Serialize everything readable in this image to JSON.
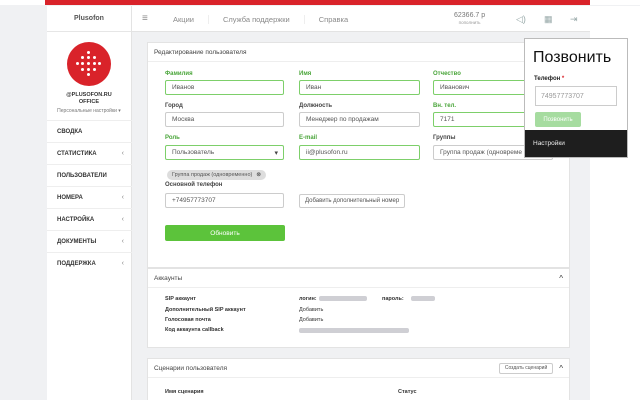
{
  "app": {
    "brand": "Plusofon"
  },
  "account": {
    "name": "@PLUSOFON.RU",
    "sub": "OFFICE",
    "settings": "Персональные настройки"
  },
  "sidebar": {
    "items": [
      {
        "label": "СВОДКА",
        "chevron": ""
      },
      {
        "label": "СТАТИСТИКА",
        "chevron": "‹"
      },
      {
        "label": "ПОЛЬЗОВАТЕЛИ",
        "chevron": ""
      },
      {
        "label": "НОМЕРА",
        "chevron": "‹"
      },
      {
        "label": "НАСТРОЙКА",
        "chevron": "‹"
      },
      {
        "label": "ДОКУМЕНТЫ",
        "chevron": "‹"
      },
      {
        "label": "ПОДДЕРЖКА",
        "chevron": "‹"
      }
    ]
  },
  "header": {
    "nav": [
      "Акции",
      "Служба поддержки",
      "Справка"
    ],
    "balance": "62366.7 р",
    "balance_sub": "пополнить"
  },
  "edit_user": {
    "title": "Редактирование пользователя",
    "fields": {
      "lastname_label": "Фамилия",
      "lastname_value": "Иванов",
      "firstname_label": "Имя",
      "firstname_value": "Иван",
      "patronymic_label": "Отчество",
      "patronymic_value": "Иванович",
      "city_label": "Город",
      "city_value": "Москва",
      "position_label": "Должность",
      "position_value": "Менеджер по продажам",
      "ext_label": "Вн. тел.",
      "ext_value": "7171",
      "role_label": "Роль",
      "role_value": "Пользователь",
      "email_label": "E-mail",
      "email_value": "ii@plusofon.ru",
      "groups_label": "Группы",
      "groups_value": "Группа продаж (одновреме",
      "tag": "Группа продаж (одновременно)",
      "phone_label": "Основной телефон",
      "phone_value": "+74957773707",
      "add_number": "Добавить дополнительный номер"
    },
    "update_button": "Обновить"
  },
  "accounts": {
    "title": "Аккаунты",
    "sip_label": "SIP аккаунт",
    "login_label": "логин:",
    "password_label": "пароль:",
    "extra_sip_label": "Дополнительный SIP аккаунт",
    "voicemail_label": "Голосовая почта",
    "callback_label": "Код аккаунта callback",
    "add1": "Добавить",
    "add2": "Добавить"
  },
  "scenarios": {
    "title": "Сценарии пользователя",
    "create_button": "Создать сценарий",
    "col_name": "Имя сценария",
    "col_status": "Статус"
  },
  "call_popup": {
    "title": "Позвонить",
    "phone_label": "Телефон",
    "required_mark": "*",
    "phone_placeholder": "74957773707",
    "call_button": "Позвонить",
    "settings": "Настройки"
  }
}
